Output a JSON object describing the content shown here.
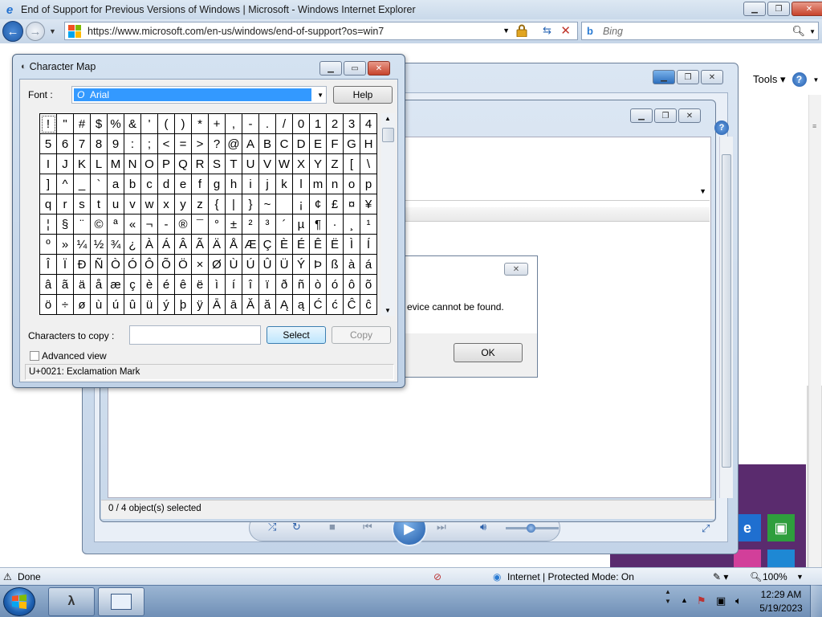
{
  "ie": {
    "title": "End of Support for Previous Versions of Windows | Microsoft - Windows Internet Explorer",
    "url": "https://www.microsoft.com/en-us/windows/end-of-support?os=win7",
    "search_placeholder": "Bing",
    "tools_label": "Tools",
    "status": {
      "done": "Done",
      "zone": "Internet | Protected Mode: On",
      "zoom": "100%"
    }
  },
  "devices_window": {
    "status_text": "0 / 4 object(s) selected"
  },
  "message_box": {
    "text": "evice cannot be found.",
    "ok_label": "OK"
  },
  "charmap": {
    "title": "Character Map",
    "font_label": "Font :",
    "font_value": "Arial",
    "help_label": "Help",
    "characters": [
      "!",
      "\"",
      "#",
      "$",
      "%",
      "&",
      "'",
      "(",
      ")",
      "*",
      "+",
      ",",
      "-",
      ".",
      "/",
      "0",
      "1",
      "2",
      "3",
      "4",
      "5",
      "6",
      "7",
      "8",
      "9",
      ":",
      ";",
      "<",
      "=",
      ">",
      "?",
      "@",
      "A",
      "B",
      "C",
      "D",
      "E",
      "F",
      "G",
      "H",
      "I",
      "J",
      "K",
      "L",
      "M",
      "N",
      "O",
      "P",
      "Q",
      "R",
      "S",
      "T",
      "U",
      "V",
      "W",
      "X",
      "Y",
      "Z",
      "[",
      "\\",
      "]",
      "^",
      "_",
      "`",
      "a",
      "b",
      "c",
      "d",
      "e",
      "f",
      "g",
      "h",
      "i",
      "j",
      "k",
      "l",
      "m",
      "n",
      "o",
      "p",
      "q",
      "r",
      "s",
      "t",
      "u",
      "v",
      "w",
      "x",
      "y",
      "z",
      "{",
      "|",
      "}",
      "~",
      " ",
      "¡",
      "¢",
      "£",
      "¤",
      "¥",
      "¦",
      "§",
      "¨",
      "©",
      "ª",
      "«",
      "¬",
      "-",
      "®",
      "¯",
      "°",
      "±",
      "²",
      "³",
      "´",
      "µ",
      "¶",
      "·",
      "¸",
      "¹",
      "º",
      "»",
      "¼",
      "½",
      "¾",
      "¿",
      "À",
      "Á",
      "Â",
      "Ã",
      "Ä",
      "Å",
      "Æ",
      "Ç",
      "È",
      "É",
      "Ê",
      "Ë",
      "Ì",
      "Í",
      "Î",
      "Ï",
      "Ð",
      "Ñ",
      "Ò",
      "Ó",
      "Ô",
      "Õ",
      "Ö",
      "×",
      "Ø",
      "Ù",
      "Ú",
      "Û",
      "Ü",
      "Ý",
      "Þ",
      "ß",
      "à",
      "á",
      "â",
      "ã",
      "ä",
      "å",
      "æ",
      "ç",
      "è",
      "é",
      "ê",
      "ë",
      "ì",
      "í",
      "î",
      "ï",
      "ð",
      "ñ",
      "ò",
      "ó",
      "ô",
      "õ",
      "ö",
      "÷",
      "ø",
      "ù",
      "ú",
      "û",
      "ü",
      "ý",
      "þ",
      "ÿ",
      "Ā",
      "ā",
      "Ă",
      "ă",
      "Ą",
      "ą",
      "Ć",
      "ć",
      "Ĉ",
      "ĉ"
    ],
    "copy_label": "Characters to copy :",
    "copy_value": "",
    "select_label": "Select",
    "copy_button_label": "Copy",
    "advanced_label": "Advanced view",
    "advanced_checked": false,
    "status": "U+0021: Exclamation Mark"
  },
  "taskbar": {
    "clock_time": "12:29 AM",
    "clock_date": "5/19/2023"
  },
  "colors": {
    "selection": "#3399ff",
    "tile_ie": "#1f6fd0",
    "tile_store": "#2e9e3d",
    "tile_office": "#d23f9a"
  },
  "icons": {
    "ie": "ie-logo-icon",
    "lock": "lock-icon",
    "bing": "bing-icon",
    "charmap": "charmap-icon"
  }
}
